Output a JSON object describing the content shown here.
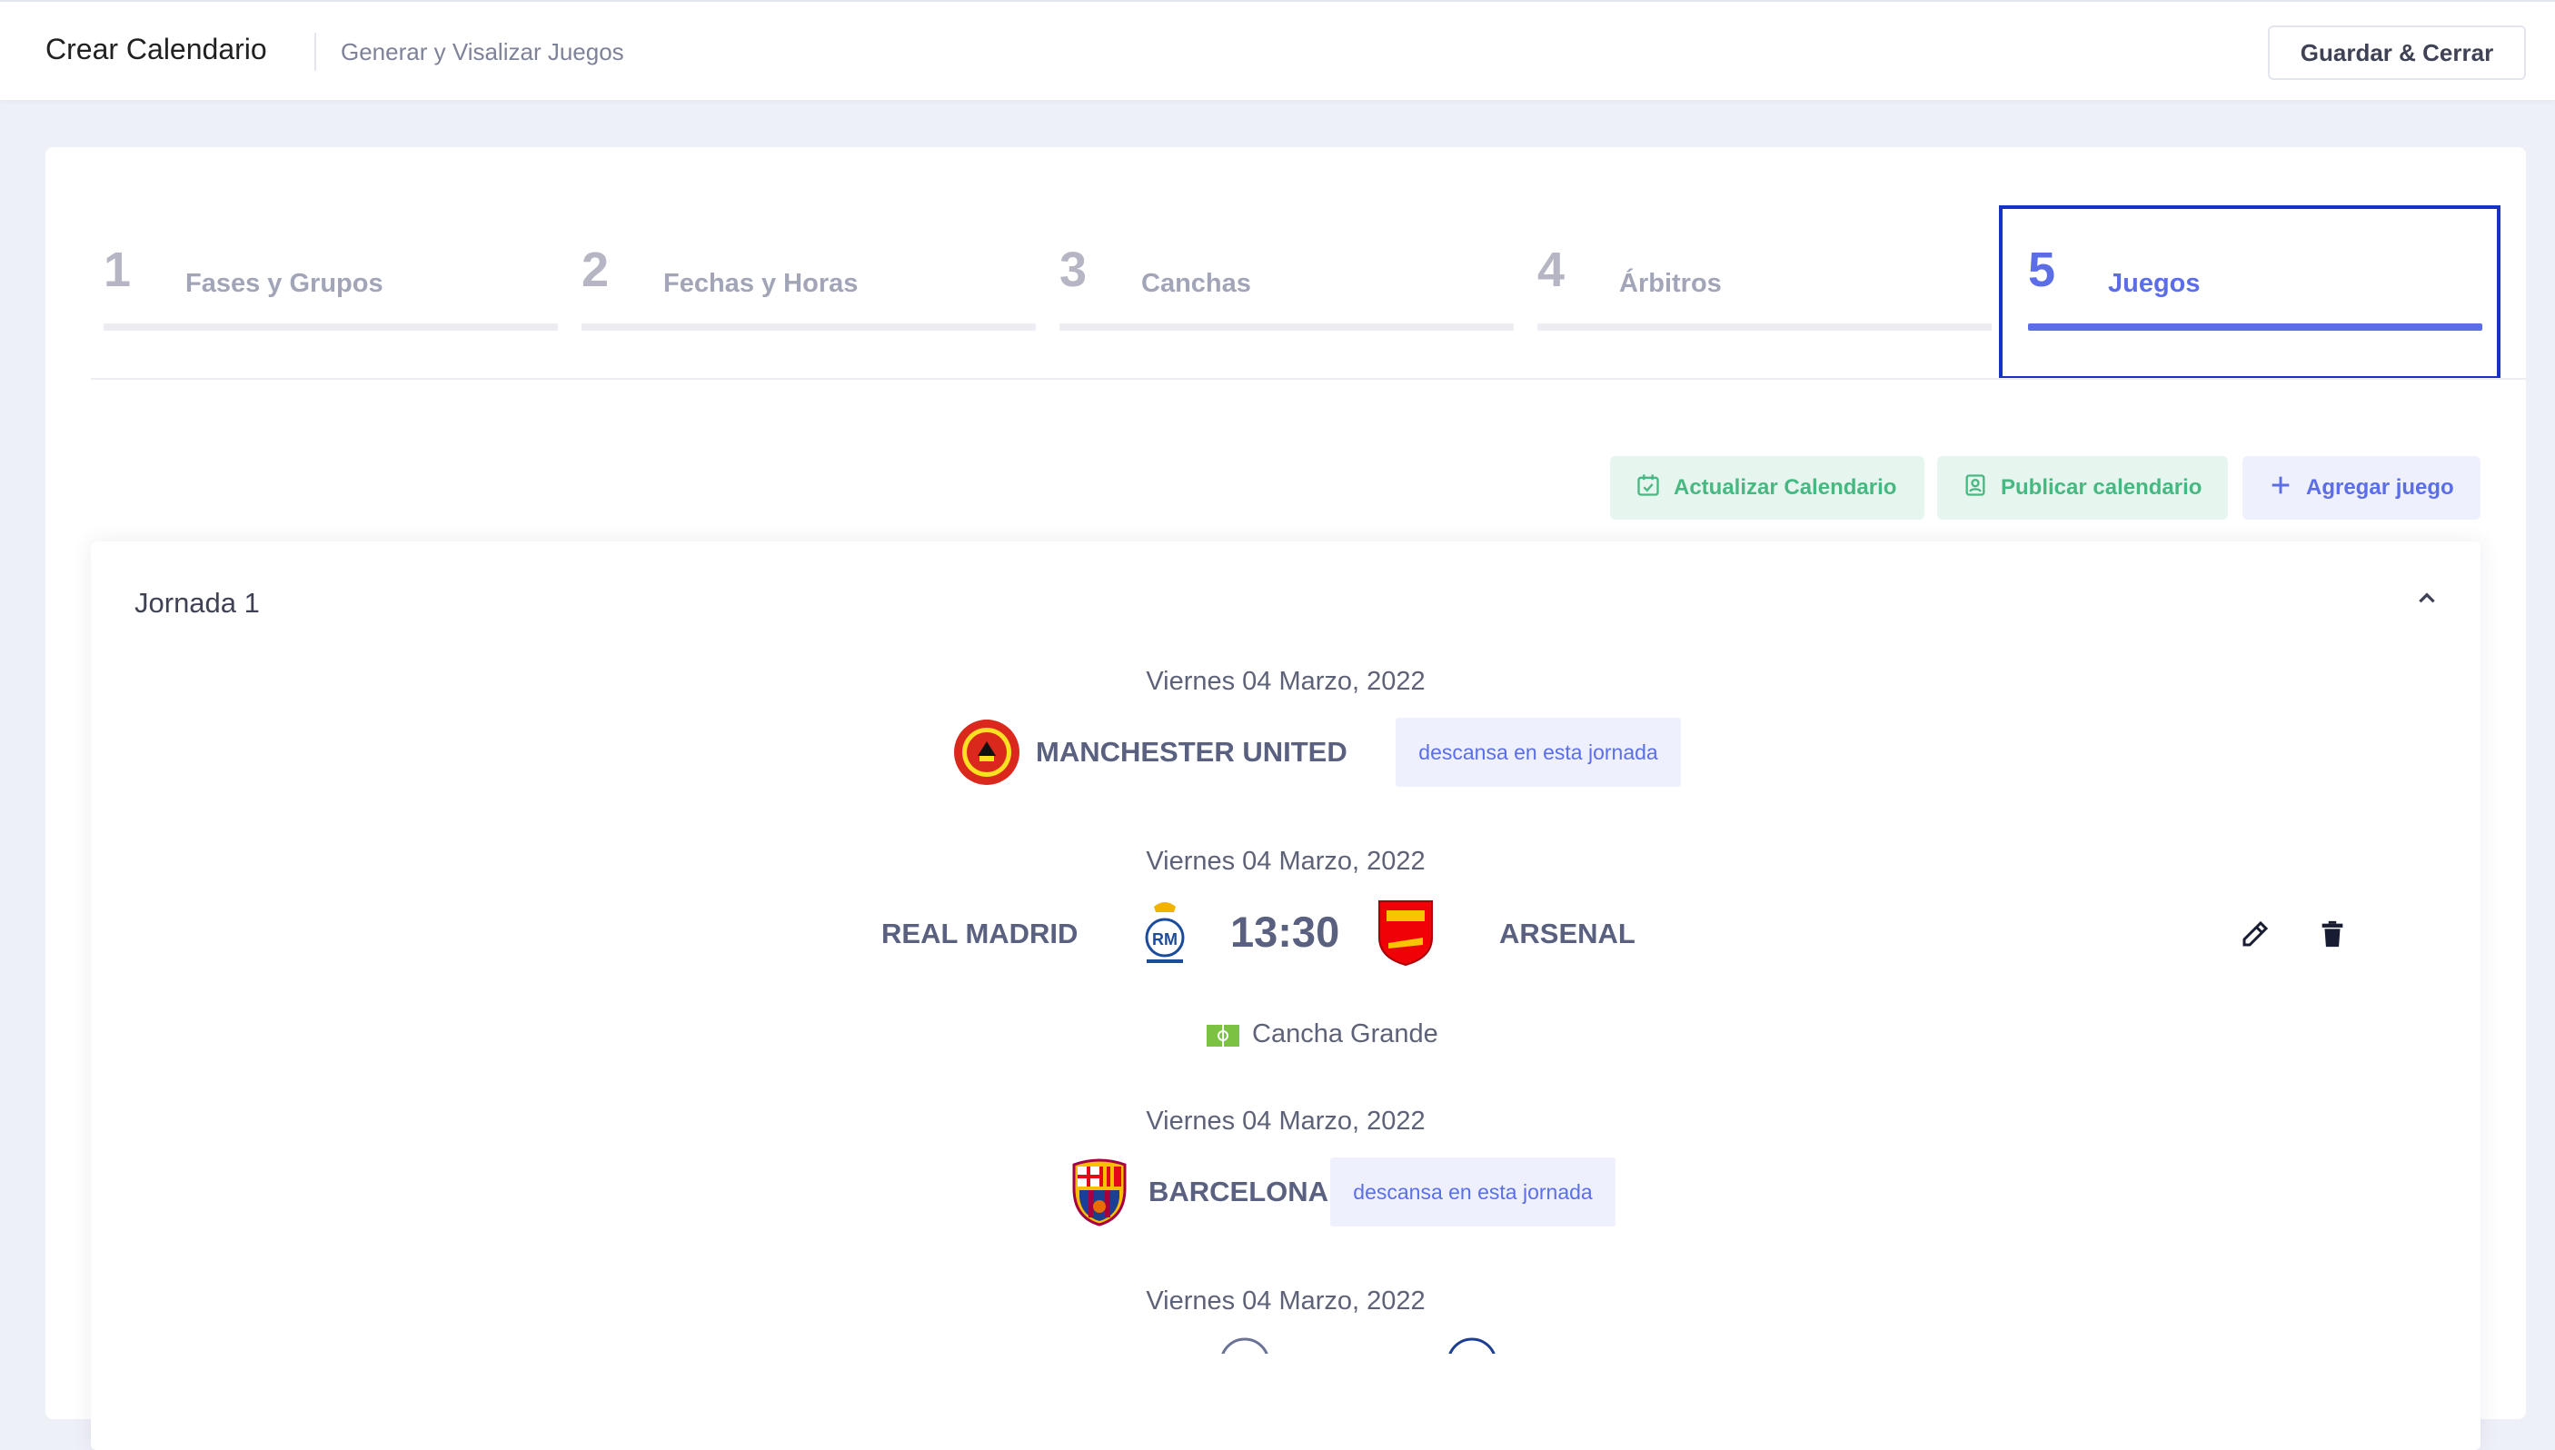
{
  "topbar": {
    "title": "Crear Calendario",
    "subtitle": "Generar y Visalizar Juegos",
    "save_close": "Guardar & Cerrar"
  },
  "steps": [
    {
      "num": "1",
      "label": "Fases y Grupos"
    },
    {
      "num": "2",
      "label": "Fechas y Horas"
    },
    {
      "num": "3",
      "label": "Canchas"
    },
    {
      "num": "4",
      "label": "Árbitros"
    },
    {
      "num": "5",
      "label": "Juegos",
      "active": true
    }
  ],
  "actions": {
    "update": "Actualizar Calendario",
    "publish": "Publicar calendario",
    "add": "Agregar juego"
  },
  "jornada": {
    "title": "Jornada 1",
    "entries": [
      {
        "date": "Viernes 04 Marzo, 2022",
        "team": "MANCHESTER UNITED",
        "rest": "descansa en esta jornada"
      },
      {
        "date": "Viernes 04 Marzo, 2022",
        "home": "REAL MADRID",
        "time": "13:30",
        "away": "ARSENAL",
        "venue": "Cancha Grande"
      },
      {
        "date": "Viernes 04 Marzo, 2022",
        "team": "BARCELONA",
        "rest": "descansa en esta jornada"
      },
      {
        "date": "Viernes 04 Marzo, 2022"
      }
    ]
  },
  "icons": {
    "collapse": "chevron-up-icon",
    "edit": "pencil-icon",
    "delete": "trash-icon",
    "calendar_check": "calendar-check-icon",
    "publish": "id-card-icon",
    "add": "plus-icon",
    "field": "soccer-field-icon"
  },
  "colors": {
    "accent": "#5b6ee8",
    "green": "#47b881",
    "highlight_border": "#1432c8"
  }
}
